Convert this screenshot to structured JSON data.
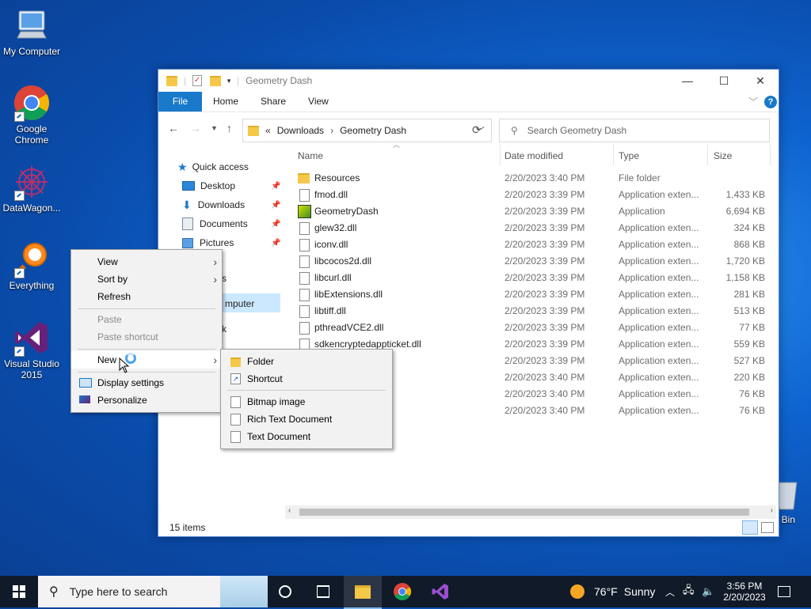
{
  "desktop": {
    "icons": [
      {
        "label": "My Computer",
        "icon": "my-computer-icon"
      },
      {
        "label": "Google Chrome",
        "icon": "chrome-icon"
      },
      {
        "label": "DataWagon...",
        "icon": "datawagon-icon"
      },
      {
        "label": "Everything",
        "icon": "everything-search-icon"
      },
      {
        "label": "Visual Studio 2015",
        "icon": "visual-studio-icon"
      },
      {
        "label": "e Bin",
        "icon": "recycle-bin-icon"
      }
    ]
  },
  "explorer": {
    "title": "Geometry Dash",
    "ribbon_tabs": [
      "File",
      "Home",
      "Share",
      "View"
    ],
    "address": {
      "overflow": "«",
      "parts": [
        "Downloads",
        "Geometry Dash"
      ]
    },
    "search_placeholder": "Search Geometry Dash",
    "nav": [
      {
        "label": "Quick access",
        "icon": "star-icon",
        "pinned": false
      },
      {
        "label": "Desktop",
        "icon": "desktop-folder-icon",
        "pinned": true
      },
      {
        "label": "Downloads",
        "icon": "downloads-folder-icon",
        "pinned": true
      },
      {
        "label": "Documents",
        "icon": "documents-folder-icon",
        "pinned": true
      },
      {
        "label": "Pictures",
        "icon": "pictures-folder-icon",
        "pinned": true
      }
    ],
    "nav_partial": [
      "s",
      "mputer",
      "k"
    ],
    "columns": [
      "Name",
      "Date modified",
      "Type",
      "Size"
    ],
    "files": [
      {
        "name": "Resources",
        "date": "2/20/2023 3:40 PM",
        "type": "File folder",
        "size": "",
        "kind": "folder"
      },
      {
        "name": "fmod.dll",
        "date": "2/20/2023 3:39 PM",
        "type": "Application exten...",
        "size": "1,433 KB",
        "kind": "dll"
      },
      {
        "name": "GeometryDash",
        "date": "2/20/2023 3:39 PM",
        "type": "Application",
        "size": "6,694 KB",
        "kind": "app"
      },
      {
        "name": "glew32.dll",
        "date": "2/20/2023 3:39 PM",
        "type": "Application exten...",
        "size": "324 KB",
        "kind": "dll"
      },
      {
        "name": "iconv.dll",
        "date": "2/20/2023 3:39 PM",
        "type": "Application exten...",
        "size": "868 KB",
        "kind": "dll"
      },
      {
        "name": "libcocos2d.dll",
        "date": "2/20/2023 3:39 PM",
        "type": "Application exten...",
        "size": "1,720 KB",
        "kind": "dll"
      },
      {
        "name": "libcurl.dll",
        "date": "2/20/2023 3:39 PM",
        "type": "Application exten...",
        "size": "1,158 KB",
        "kind": "dll"
      },
      {
        "name": "libExtensions.dll",
        "date": "2/20/2023 3:39 PM",
        "type": "Application exten...",
        "size": "281 KB",
        "kind": "dll"
      },
      {
        "name": "libtiff.dll",
        "date": "2/20/2023 3:39 PM",
        "type": "Application exten...",
        "size": "513 KB",
        "kind": "dll"
      },
      {
        "name": "pthreadVCE2.dll",
        "date": "2/20/2023 3:39 PM",
        "type": "Application exten...",
        "size": "77 KB",
        "kind": "dll"
      },
      {
        "name": "sdkencryptedappticket.dll",
        "date": "2/20/2023 3:39 PM",
        "type": "Application exten...",
        "size": "559 KB",
        "kind": "dll"
      },
      {
        "name": "",
        "date": "2/20/2023 3:39 PM",
        "type": "Application exten...",
        "size": "527 KB",
        "kind": "hidden"
      },
      {
        "name": "",
        "date": "2/20/2023 3:40 PM",
        "type": "Application exten...",
        "size": "220 KB",
        "kind": "hidden"
      },
      {
        "name": "",
        "date": "2/20/2023 3:40 PM",
        "type": "Application exten...",
        "size": "76 KB",
        "kind": "hidden"
      },
      {
        "name": "",
        "date": "2/20/2023 3:40 PM",
        "type": "Application exten...",
        "size": "76 KB",
        "kind": "hidden"
      }
    ],
    "status": "15 items"
  },
  "context_menu": {
    "items": [
      {
        "label": "View",
        "submenu": true,
        "disabled": false
      },
      {
        "label": "Sort by",
        "submenu": true,
        "disabled": false
      },
      {
        "label": "Refresh",
        "submenu": false,
        "disabled": false
      },
      {
        "label": "Paste",
        "submenu": false,
        "disabled": true
      },
      {
        "label": "Paste shortcut",
        "submenu": false,
        "disabled": true
      },
      {
        "label": "New",
        "submenu": true,
        "disabled": false
      },
      {
        "label": "Display settings",
        "submenu": false,
        "disabled": false,
        "icon": "display-icon"
      },
      {
        "label": "Personalize",
        "submenu": false,
        "disabled": false,
        "icon": "personalize-icon"
      }
    ]
  },
  "new_submenu": {
    "items": [
      {
        "label": "Folder",
        "icon": "folder-icon"
      },
      {
        "label": "Shortcut",
        "icon": "shortcut-icon"
      },
      {
        "label": "Bitmap image",
        "icon": "bitmap-icon"
      },
      {
        "label": "Rich Text Document",
        "icon": "rtf-icon"
      },
      {
        "label": "Text Document",
        "icon": "text-document-icon"
      }
    ]
  },
  "taskbar": {
    "search_placeholder": "Type here to search",
    "weather": {
      "temp": "76°F",
      "condition": "Sunny"
    },
    "time": "3:56 PM",
    "date": "2/20/2023"
  },
  "colors": {
    "accent": "#1979ca",
    "taskbar": "#101a28",
    "desktop": "#0e63cf"
  }
}
